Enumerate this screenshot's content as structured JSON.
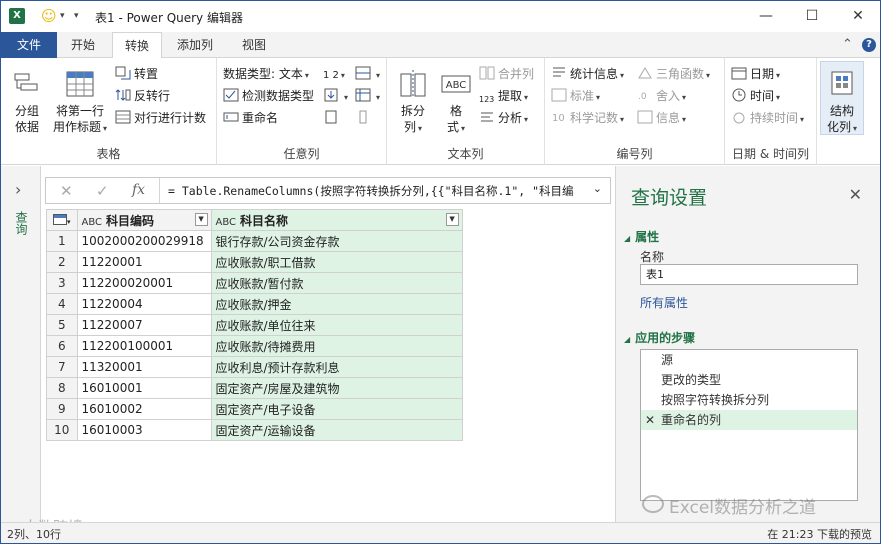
{
  "window": {
    "title": "表1 - Power Query 编辑器",
    "app_logo": "X",
    "minimize_icon": "minimize-icon",
    "maximize_icon": "maximize-icon",
    "close_icon": "close-icon"
  },
  "tabs": [
    {
      "label": "文件"
    },
    {
      "label": "开始"
    },
    {
      "label": "转换",
      "active": true
    },
    {
      "label": "添加列"
    },
    {
      "label": "视图"
    }
  ],
  "ribbon": {
    "table_group": {
      "label": "表格",
      "group_by": "分组\n依据",
      "use_first_row": "将第一行\n用作标题",
      "transpose": "转置",
      "reverse_rows": "反转行",
      "count_rows": "对行进行计数"
    },
    "any_column_group": {
      "label": "任意列",
      "data_type": "数据类型: 文本",
      "detect_type": "检测数据类型",
      "rename": "重命名",
      "replace_label": "1 2"
    },
    "text_column_group": {
      "label": "文本列",
      "split_column": "拆分\n列",
      "format": "格\n式",
      "merge_columns": "合并列",
      "extract": "提取",
      "parse": "分析",
      "abc_label": "ABC",
      "num_label": "123"
    },
    "number_column_group": {
      "label": "编号列",
      "statistics": "统计信息",
      "standard": "标准",
      "scientific": "科学记数",
      "trigonometry": "三角函数",
      "rounding": "舍入",
      "information": "信息"
    },
    "datetime_group": {
      "label": "日期 & 时间列",
      "date": "日期",
      "time": "时间",
      "duration": "持续时间"
    },
    "structured_group": {
      "structured_column": "结构\n化列"
    }
  },
  "left_pane": {
    "label": "查询"
  },
  "formula_bar": {
    "formula": "= Table.RenameColumns(按照字符转换拆分列,{{\"科目名称.1\", \"科目编"
  },
  "grid": {
    "type_prefix": "ABC",
    "headers": [
      "科目编码",
      "科目名称"
    ],
    "rows": [
      {
        "n": "1",
        "code": "1002000200029918",
        "name": "银行存款/公司资金存款"
      },
      {
        "n": "2",
        "code": "11220001",
        "name": "应收账款/职工借款"
      },
      {
        "n": "3",
        "code": "112200020001",
        "name": "应收账款/暂付款"
      },
      {
        "n": "4",
        "code": "11220004",
        "name": "应收账款/押金"
      },
      {
        "n": "5",
        "code": "11220007",
        "name": "应收账款/单位往来"
      },
      {
        "n": "6",
        "code": "112200100001",
        "name": "应收账款/待摊费用"
      },
      {
        "n": "7",
        "code": "11320001",
        "name": "应收利息/预计存款利息"
      },
      {
        "n": "8",
        "code": "16010001",
        "name": "固定资产/房屋及建筑物"
      },
      {
        "n": "9",
        "code": "16010002",
        "name": "固定资产/电子设备"
      },
      {
        "n": "10",
        "code": "16010003",
        "name": "固定资产/运输设备"
      }
    ]
  },
  "query_settings": {
    "title": "查询设置",
    "properties_header": "属性",
    "name_label": "名称",
    "name_value": "表1",
    "all_properties_link": "所有属性",
    "applied_steps_header": "应用的步骤",
    "steps": [
      "源",
      "更改的类型",
      "按照字符转换拆分列",
      "重命名的列"
    ],
    "selected_step_index": 3
  },
  "status_bar": {
    "left": "2列、10行",
    "right": "在 21:23 下载的预览"
  },
  "watermarks": {
    "left": "大数跨境",
    "right": "Excel数据分析之道"
  },
  "colors": {
    "accent_blue": "#2b579a",
    "excel_green": "#217346",
    "selected_column": "#dff3e5"
  }
}
